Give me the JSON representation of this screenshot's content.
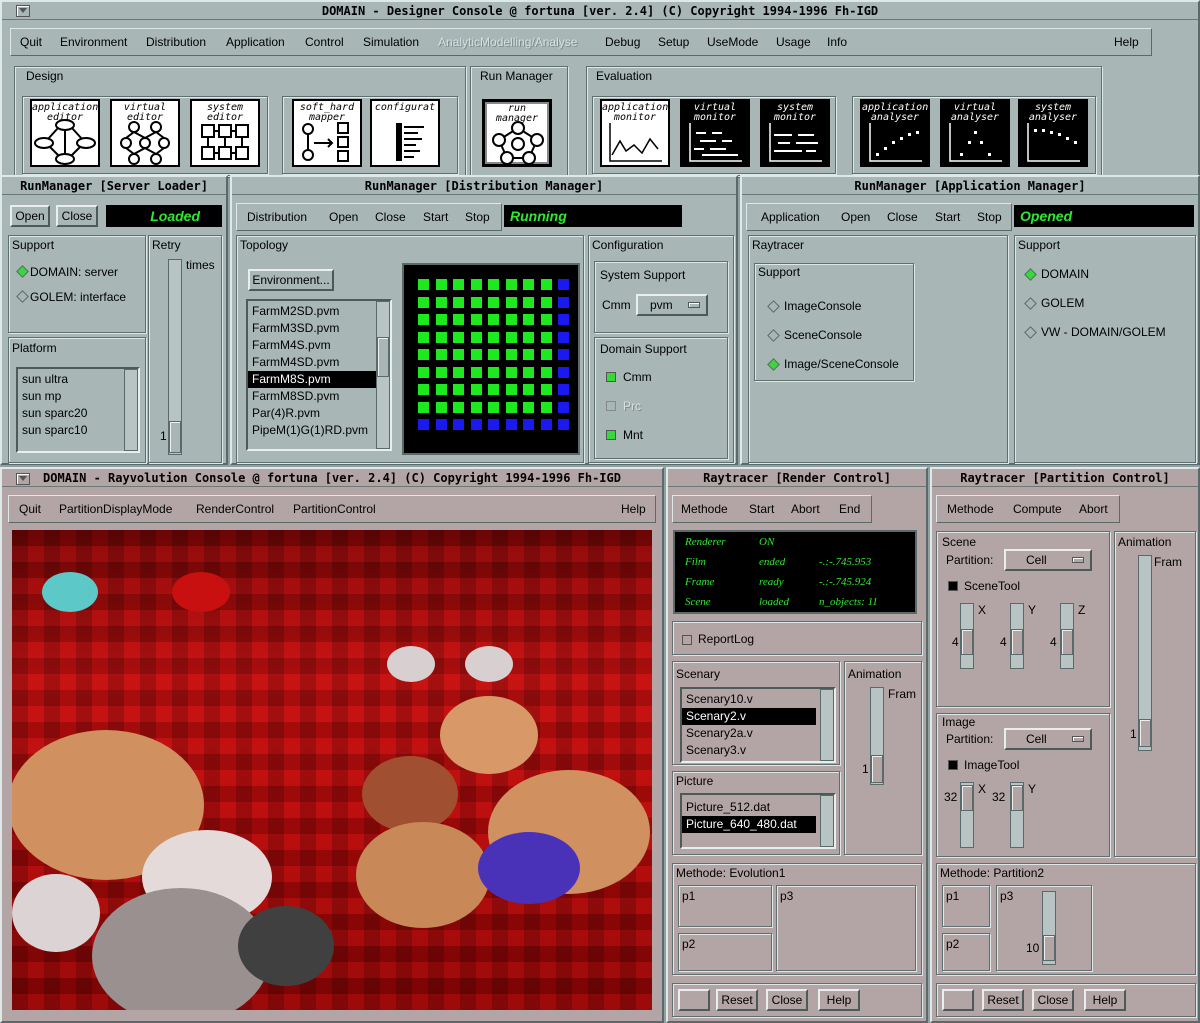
{
  "designer": {
    "title": "DOMAIN - Designer Console @ fortuna  [ver. 2.4]  (C) Copyright 1994-1996  Fh-IGD",
    "menu": [
      "Quit",
      "Environment",
      "Distribution",
      "Application",
      "Control",
      "Simulation",
      "AnalyticModelling/Analyse",
      "Debug",
      "Setup",
      "UseMode",
      "Usage",
      "Info",
      "Help"
    ],
    "groups": {
      "design": "Design",
      "run_manager": "Run Manager",
      "evaluation": "Evaluation"
    },
    "tools": [
      "application editor",
      "virtual editor",
      "system editor",
      "soft_hard mapper",
      "configurat",
      "run manager",
      "application monitor",
      "virtual monitor",
      "system monitor",
      "application analyser",
      "virtual analyser",
      "system analyser"
    ]
  },
  "server_loader": {
    "title": "RunManager [Server Loader]",
    "open": "Open",
    "close": "Close",
    "status": "Loaded",
    "support_label": "Support",
    "support_items": [
      "DOMAIN: server",
      "GOLEM:  interface"
    ],
    "retry_label": "Retry",
    "times": "times",
    "retry_value": "1",
    "platform_label": "Platform",
    "platforms": [
      "sun ultra",
      "sun mp",
      "sun sparc20",
      "sun sparc10"
    ]
  },
  "dist_manager": {
    "title": "RunManager [Distribution Manager]",
    "menu": [
      "Distribution",
      "Open",
      "Close",
      "Start",
      "Stop"
    ],
    "status": "Running",
    "topology_label": "Topology",
    "env_button": "Environment...",
    "files": [
      "FarmM2SD.pvm",
      "FarmM3SD.pvm",
      "FarmM4S.pvm",
      "FarmM4SD.pvm",
      "FarmM8S.pvm",
      "FarmM8SD.pvm",
      "Par(4)R.pvm",
      "PipeM(1)G(1)RD.pvm"
    ],
    "selected_file": 4,
    "config_label": "Configuration",
    "system_support": "System Support",
    "cmm_label": "Cmm",
    "cmm_value": "pvm",
    "domain_support": "Domain Support",
    "checks": [
      "Cmm",
      "Prc",
      "Mnt"
    ],
    "grid_colors": {
      "active": "#1ee81e",
      "io": "#1a1aee"
    }
  },
  "app_manager": {
    "title": "RunManager [Application Manager]",
    "menu": [
      "Application",
      "Open",
      "Close",
      "Start",
      "Stop"
    ],
    "status": "Opened",
    "raytracer_label": "Raytracer",
    "support_label": "Support",
    "support_items": [
      "ImageConsole",
      "SceneConsole",
      "Image/SceneConsole"
    ],
    "right_support_label": "Support",
    "right_items": [
      "DOMAIN",
      "GOLEM",
      "VW - DOMAIN/GOLEM"
    ]
  },
  "rayvolution": {
    "title": "DOMAIN - Rayvolution Console @ fortuna [ver. 2.4] (C) Copyright 1994-1996  Fh-IGD",
    "menu": [
      "Quit",
      "PartitionDisplayMode",
      "RenderControl",
      "PartitionControl",
      "Help"
    ]
  },
  "render_control": {
    "title": "Raytracer [Render Control]",
    "menu": [
      "Methode",
      "Start",
      "Abort",
      "End"
    ],
    "status_rows": [
      [
        "Renderer",
        "ON",
        ""
      ],
      [
        "Film",
        "ended",
        "-.:-.745.953"
      ],
      [
        "Frame",
        "ready",
        "-.:-.745.924"
      ],
      [
        "Scene",
        "loaded",
        "n_objects:  11"
      ]
    ],
    "report_log": "ReportLog",
    "scenary_label": "Scenary",
    "scenary": [
      "Scenary10.v",
      "Scenary2.v",
      "Scenary2a.v",
      "Scenary3.v"
    ],
    "animation_label": "Animation",
    "fram": "Fram",
    "anim_value": "1",
    "picture_label": "Picture",
    "pictures": [
      "Picture_512.dat",
      "Picture_640_480.dat"
    ],
    "methode_label": "Methode: Evolution1",
    "params": [
      "p1",
      "p2",
      "p3"
    ],
    "buttons": [
      "Reset",
      "Close",
      "Help"
    ]
  },
  "partition_control": {
    "title": "Raytracer [Partition Control]",
    "menu": [
      "Methode",
      "Compute",
      "Abort"
    ],
    "scene_label": "Scene",
    "partition_label": "Partition:",
    "partition_value": "Cell",
    "scene_tool": "SceneTool",
    "axes3": [
      "X",
      "Y",
      "Z"
    ],
    "axis_values": [
      "4",
      "4",
      "4"
    ],
    "image_label": "Image",
    "image_tool": "ImageTool",
    "axes2": [
      "X",
      "Y"
    ],
    "image_values": [
      "32",
      "32"
    ],
    "animation_label": "Animation",
    "fram": "Fram",
    "anim_value": "1",
    "methode_label": "Methode: Partition2",
    "params": [
      "p1",
      "p2",
      "p3"
    ],
    "p3_value": "10",
    "buttons": [
      "Reset",
      "Close",
      "Help"
    ]
  }
}
